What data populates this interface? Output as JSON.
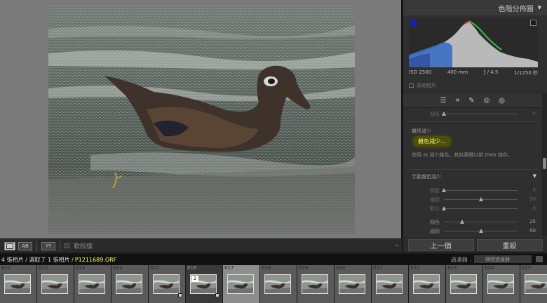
{
  "histogram": {
    "title": "色階分佈圖",
    "iso": "ISO 2500",
    "focal": "400 mm",
    "aperture": "ƒ / 4.5",
    "shutter": "1/1250 秒",
    "original_label": "原始相片"
  },
  "toolbar": {
    "view_a_label": "▭",
    "view_b_label": "AB",
    "view_c_label": "YY",
    "softproof_label": "軟校樣"
  },
  "detail": {
    "color_row_label": "顏色",
    "color_row_value": "0",
    "nr_title": "雜訊減少",
    "denoise_label": "雜色減少...",
    "denoise_desc": "使用 AI 減少雜色，其結果轉以新 DNG 儲存。",
    "manual_title": "手動雜色減少",
    "sliders": [
      {
        "label": "明度",
        "value": "0",
        "pos": 0.0
      },
      {
        "label": "細節",
        "value": "50",
        "pos": 0.5
      },
      {
        "label": "對比",
        "value": "0",
        "pos": 0.0
      },
      {
        "label": "顏色",
        "value": "25",
        "pos": 0.25
      },
      {
        "label": "細節",
        "value": "50",
        "pos": 0.5
      }
    ],
    "prev_label": "上一個",
    "reset_label": "重設"
  },
  "status": {
    "path": "4 張相片 / 選取了 1 張相片 /",
    "filename": "P1211689.ORF",
    "filter_label": "過濾器 :",
    "filter_value": "關閉過濾器"
  },
  "filmstrip": [
    {
      "num": "811"
    },
    {
      "num": "812"
    },
    {
      "num": "813"
    },
    {
      "num": "814"
    },
    {
      "num": "815"
    },
    {
      "num": "816",
      "badge": "2"
    },
    {
      "num": "817"
    },
    {
      "num": "818"
    },
    {
      "num": "819"
    },
    {
      "num": "820"
    },
    {
      "num": "821"
    },
    {
      "num": "822"
    },
    {
      "num": "823"
    },
    {
      "num": "824"
    },
    {
      "num": "825"
    }
  ],
  "colors": {
    "accent": "#ffff66",
    "panel": "#2f2f2f",
    "viewer_bg": "#7a7a7a"
  }
}
